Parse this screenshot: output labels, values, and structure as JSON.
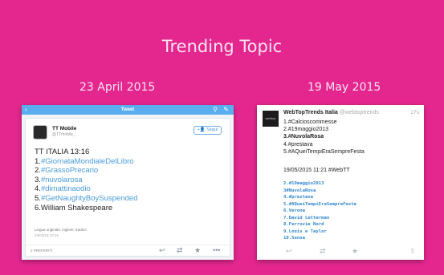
{
  "slide": {
    "title": "Trending Topic",
    "left_date": "23 April 2015",
    "right_date": "19 May 2015"
  },
  "left_panel": {
    "app_bar": {
      "title": "Tweet",
      "back_icon": "chevron-left-icon",
      "search_icon": "search-icon",
      "compose_icon": "compose-icon"
    },
    "author": {
      "name": "TT Mobile",
      "handle": "@TTmobile_"
    },
    "follow_label": "+👤 Segui",
    "tweet_lines": [
      {
        "prefix": "",
        "text": "TT ITALIA 13:16"
      },
      {
        "prefix": "1.",
        "text": "#GiornataMondialeDelLibro"
      },
      {
        "prefix": "2.",
        "text": "#GrassoPrecario"
      },
      {
        "prefix": "3.",
        "text": "#nuvolarosa"
      },
      {
        "prefix": "4.",
        "text": "#dimattinaodio"
      },
      {
        "prefix": "5.",
        "text": "#GetNaughtyBoySuspended"
      },
      {
        "prefix": "",
        "text": "6.William Shakespeare"
      }
    ],
    "language_note": "Lingua originale: inglese; traduci",
    "timestamp": "23/04/15 13:16",
    "favorites": "2 PREFERITI",
    "actions": {
      "reply_icon": "reply-icon",
      "retweet_icon": "retweet-icon",
      "favorite_icon": "star-icon",
      "more_icon": "more-icon"
    }
  },
  "right_panel": {
    "avatar_text": "webtop",
    "author": {
      "name": "WebTopTrends Italia",
      "handle": "@webtoptrends"
    },
    "age": "27s",
    "list": [
      {
        "text": "1.#Calcioscommesse",
        "bold": false
      },
      {
        "text": "2.#19maggio2013",
        "bold": false
      },
      {
        "text": "3.#NuvolaRosa",
        "bold": true
      },
      {
        "text": "4.#prestava",
        "bold": false
      },
      {
        "text": "5.#AQueiTempiEraSempreFesta",
        "bold": false
      }
    ],
    "dateline": "19/05/2015 11:21 #WebTT",
    "mono_list": [
      "2.#19maggio2013",
      "3#NuvolaRosa",
      "4.#prestava",
      "5.#AQueiTempiEraSempreFesta",
      "6.Verona",
      "7.David Letterman",
      "8.Ferrovie Nord",
      "9.Louis e Taylor",
      "10.Sonsa"
    ],
    "actions": {
      "reply_icon": "reply-icon",
      "retweet_icon": "retweet-icon",
      "favorite_icon": "star-icon",
      "share_icon": "share-icon"
    }
  }
}
